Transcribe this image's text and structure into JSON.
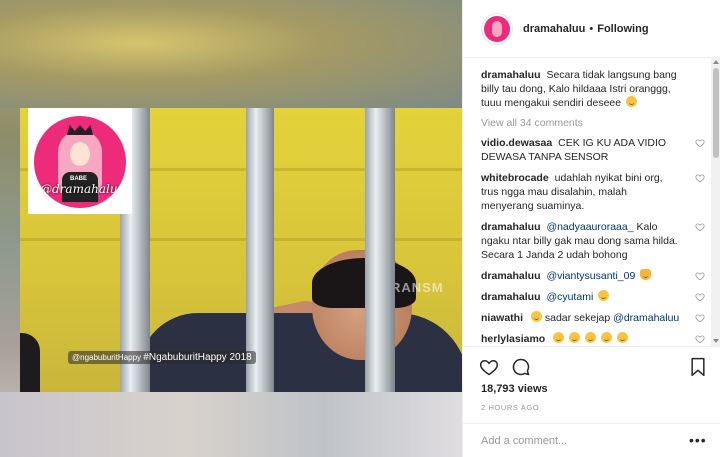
{
  "media": {
    "video_watermark": "TRANSM",
    "video_caption_handle": "@ngabuburitHappy",
    "video_caption_tag": "#NgabuburitHappy 2018",
    "logo_shirt_text": "BABE",
    "logo_script": "@dramahaluu"
  },
  "header": {
    "username": "dramahaluu",
    "separator": "•",
    "follow_status": "Following"
  },
  "post": {
    "caption_user": "dramahaluu",
    "caption_text": "Secara tidak langsung bang billy tau dong, Kalo hildaaa Istri oranggg, tuuu mengakui sendiri deseee",
    "view_all": "View all 34 comments"
  },
  "comments": [
    {
      "user": "vidio.dewasaa",
      "text": "CEK IG KU ADA VIDIO DEWASA TANPA SENSOR"
    },
    {
      "user": "whitebrocade",
      "text": "udahlah nyikat bini org, trus ngga mau disalahin, malah menyerang suaminya."
    },
    {
      "user": "dramahaluu",
      "mention": "@nadyaauroraaa_",
      "text": "Kalo ngaku ntar billy gak mau dong sama hilda. Secara 1 Janda 2 udah bohong"
    },
    {
      "user": "dramahaluu",
      "mention": "@viantysusanti_09",
      "text": ""
    },
    {
      "user": "dramahaluu",
      "mention": "@cyutami",
      "text": ""
    },
    {
      "user": "niawathi",
      "text": "sadar sekejap",
      "mention_after": "@dramahaluu"
    },
    {
      "user": "herlylasiamo",
      "text": ""
    }
  ],
  "stats": {
    "views": "18,793 views",
    "timestamp": "2 HOURS AGO"
  },
  "composer": {
    "placeholder": "Add a comment...",
    "more": "•••"
  },
  "colors": {
    "brand_pink": "#ee2a7b",
    "link_blue": "#003569",
    "muted_gray": "#999999"
  }
}
